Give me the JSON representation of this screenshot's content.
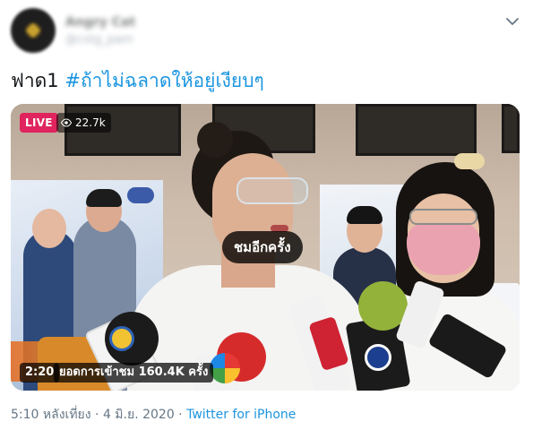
{
  "tweet": {
    "author_name": "Angry Cat",
    "author_handle": "@cstg_pam",
    "text_prefix": "ฟาด1 ",
    "hashtag": "#ถ้าไม่ฉลาดให้อยู่เงียบๆ"
  },
  "video": {
    "live_label": "LIVE",
    "views_short": "22.7k",
    "watch_again_label": "ชมอีกครั้ง",
    "duration": "2:20",
    "view_count_text": "ยอดการเข้าชม 160.4K ครั้ง"
  },
  "meta": {
    "time": "5:10 หลังเที่ยง",
    "separator": " · ",
    "date": "4 มิ.ย. 2020",
    "source": "Twitter for iPhone"
  },
  "icons": {
    "menu": "chevron-down-icon",
    "views": "eye-icon"
  },
  "colors": {
    "link": "#1b95e0",
    "live": "#e0245e",
    "meta": "#657786"
  }
}
